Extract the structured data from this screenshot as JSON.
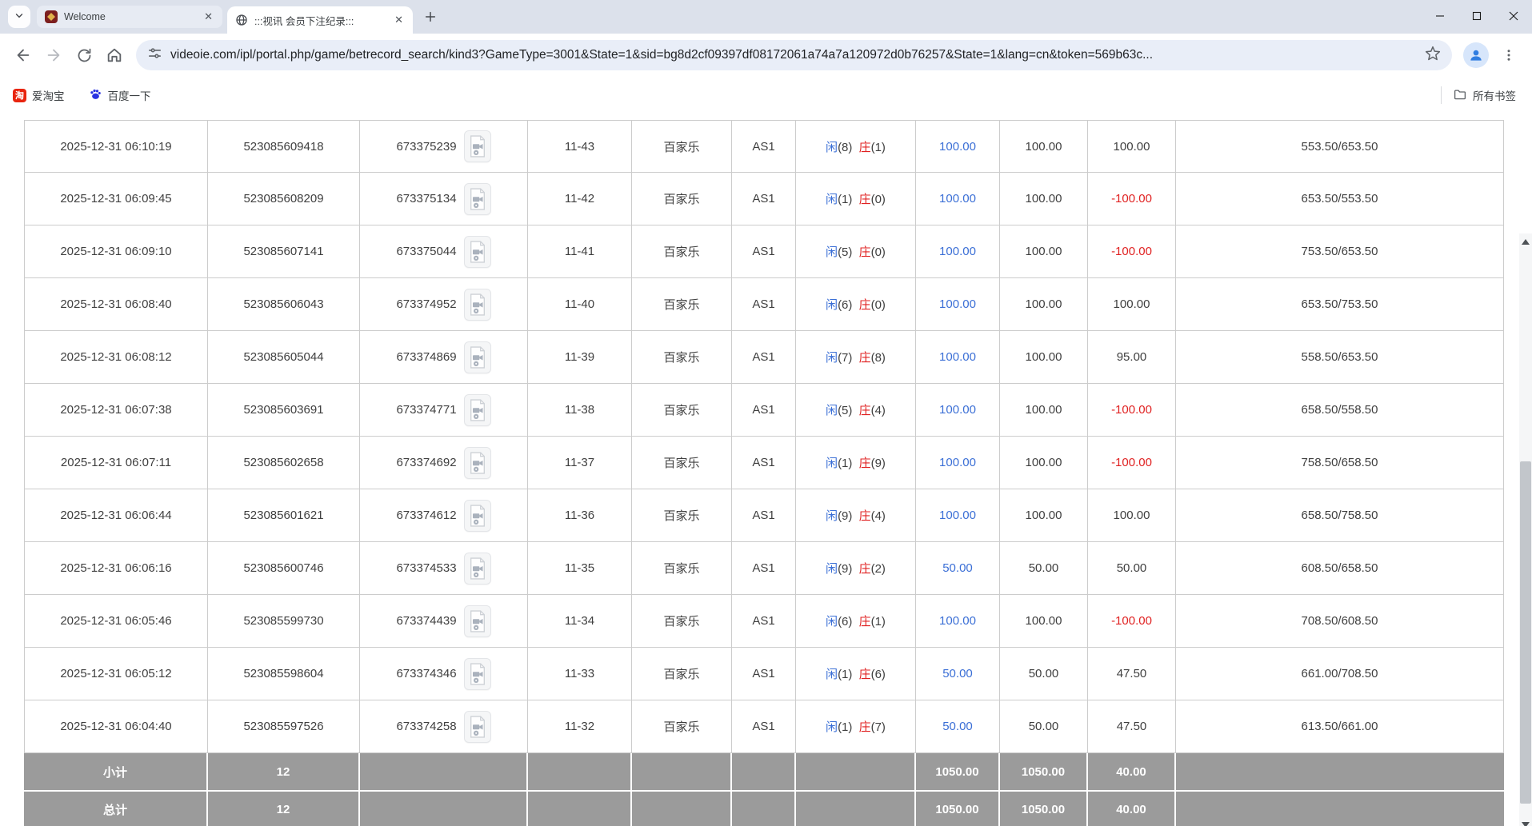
{
  "browser": {
    "tabs": [
      {
        "title": "Welcome"
      },
      {
        "title": ":::视讯 会员下注纪录:::"
      }
    ],
    "url": "videoie.com/ipl/portal.php/game/betrecord_search/kind3?GameType=3001&State=1&sid=bg8d2cf09397df08172061a74a7a120972d0b76257&State=1&lang=cn&token=569b63c...",
    "bookmarks": {
      "taobao": "爱淘宝",
      "baidu": "百度一下",
      "all_bookmarks": "所有书签",
      "taobao_icon_char": "淘"
    }
  },
  "page": {
    "rows": [
      {
        "time": "2025-12-31 06:10:19",
        "bet_id": "523085609418",
        "game_id": "673375239",
        "round": "11-43",
        "game": "百家乐",
        "table": "AS1",
        "player": "闲",
        "player_n": "(8)",
        "banker": "庄",
        "banker_n": "(1)",
        "amount": "100.00",
        "valid": "100.00",
        "winloss": "100.00",
        "balance": "553.50/653.50"
      },
      {
        "time": "2025-12-31 06:09:45",
        "bet_id": "523085608209",
        "game_id": "673375134",
        "round": "11-42",
        "game": "百家乐",
        "table": "AS1",
        "player": "闲",
        "player_n": "(1)",
        "banker": "庄",
        "banker_n": "(0)",
        "amount": "100.00",
        "valid": "100.00",
        "winloss": "-100.00",
        "balance": "653.50/553.50"
      },
      {
        "time": "2025-12-31 06:09:10",
        "bet_id": "523085607141",
        "game_id": "673375044",
        "round": "11-41",
        "game": "百家乐",
        "table": "AS1",
        "player": "闲",
        "player_n": "(5)",
        "banker": "庄",
        "banker_n": "(0)",
        "amount": "100.00",
        "valid": "100.00",
        "winloss": "-100.00",
        "balance": "753.50/653.50"
      },
      {
        "time": "2025-12-31 06:08:40",
        "bet_id": "523085606043",
        "game_id": "673374952",
        "round": "11-40",
        "game": "百家乐",
        "table": "AS1",
        "player": "闲",
        "player_n": "(6)",
        "banker": "庄",
        "banker_n": "(0)",
        "amount": "100.00",
        "valid": "100.00",
        "winloss": "100.00",
        "balance": "653.50/753.50"
      },
      {
        "time": "2025-12-31 06:08:12",
        "bet_id": "523085605044",
        "game_id": "673374869",
        "round": "11-39",
        "game": "百家乐",
        "table": "AS1",
        "player": "闲",
        "player_n": "(7)",
        "banker": "庄",
        "banker_n": "(8)",
        "amount": "100.00",
        "valid": "100.00",
        "winloss": "95.00",
        "balance": "558.50/653.50"
      },
      {
        "time": "2025-12-31 06:07:38",
        "bet_id": "523085603691",
        "game_id": "673374771",
        "round": "11-38",
        "game": "百家乐",
        "table": "AS1",
        "player": "闲",
        "player_n": "(5)",
        "banker": "庄",
        "banker_n": "(4)",
        "amount": "100.00",
        "valid": "100.00",
        "winloss": "-100.00",
        "balance": "658.50/558.50"
      },
      {
        "time": "2025-12-31 06:07:11",
        "bet_id": "523085602658",
        "game_id": "673374692",
        "round": "11-37",
        "game": "百家乐",
        "table": "AS1",
        "player": "闲",
        "player_n": "(1)",
        "banker": "庄",
        "banker_n": "(9)",
        "amount": "100.00",
        "valid": "100.00",
        "winloss": "-100.00",
        "balance": "758.50/658.50"
      },
      {
        "time": "2025-12-31 06:06:44",
        "bet_id": "523085601621",
        "game_id": "673374612",
        "round": "11-36",
        "game": "百家乐",
        "table": "AS1",
        "player": "闲",
        "player_n": "(9)",
        "banker": "庄",
        "banker_n": "(4)",
        "amount": "100.00",
        "valid": "100.00",
        "winloss": "100.00",
        "balance": "658.50/758.50"
      },
      {
        "time": "2025-12-31 06:06:16",
        "bet_id": "523085600746",
        "game_id": "673374533",
        "round": "11-35",
        "game": "百家乐",
        "table": "AS1",
        "player": "闲",
        "player_n": "(9)",
        "banker": "庄",
        "banker_n": "(2)",
        "amount": "50.00",
        "valid": "50.00",
        "winloss": "50.00",
        "balance": "608.50/658.50"
      },
      {
        "time": "2025-12-31 06:05:46",
        "bet_id": "523085599730",
        "game_id": "673374439",
        "round": "11-34",
        "game": "百家乐",
        "table": "AS1",
        "player": "闲",
        "player_n": "(6)",
        "banker": "庄",
        "banker_n": "(1)",
        "amount": "100.00",
        "valid": "100.00",
        "winloss": "-100.00",
        "balance": "708.50/608.50"
      },
      {
        "time": "2025-12-31 06:05:12",
        "bet_id": "523085598604",
        "game_id": "673374346",
        "round": "11-33",
        "game": "百家乐",
        "table": "AS1",
        "player": "闲",
        "player_n": "(1)",
        "banker": "庄",
        "banker_n": "(6)",
        "amount": "50.00",
        "valid": "50.00",
        "winloss": "47.50",
        "balance": "661.00/708.50"
      },
      {
        "time": "2025-12-31 06:04:40",
        "bet_id": "523085597526",
        "game_id": "673374258",
        "round": "11-32",
        "game": "百家乐",
        "table": "AS1",
        "player": "闲",
        "player_n": "(1)",
        "banker": "庄",
        "banker_n": "(7)",
        "amount": "50.00",
        "valid": "50.00",
        "winloss": "47.50",
        "balance": "613.50/661.00"
      }
    ],
    "summary_rows": [
      {
        "label": "小计",
        "count": "12",
        "amount": "1050.00",
        "valid": "1050.00",
        "winloss": "40.00"
      },
      {
        "label": "总计",
        "count": "12",
        "amount": "1050.00",
        "valid": "1050.00",
        "winloss": "40.00"
      }
    ]
  },
  "colors": {
    "link_blue": "#3b6fd6",
    "loss_red": "#e02222",
    "summary_gray": "#9b9b9b",
    "tabbar_bg": "#dce1eb"
  }
}
